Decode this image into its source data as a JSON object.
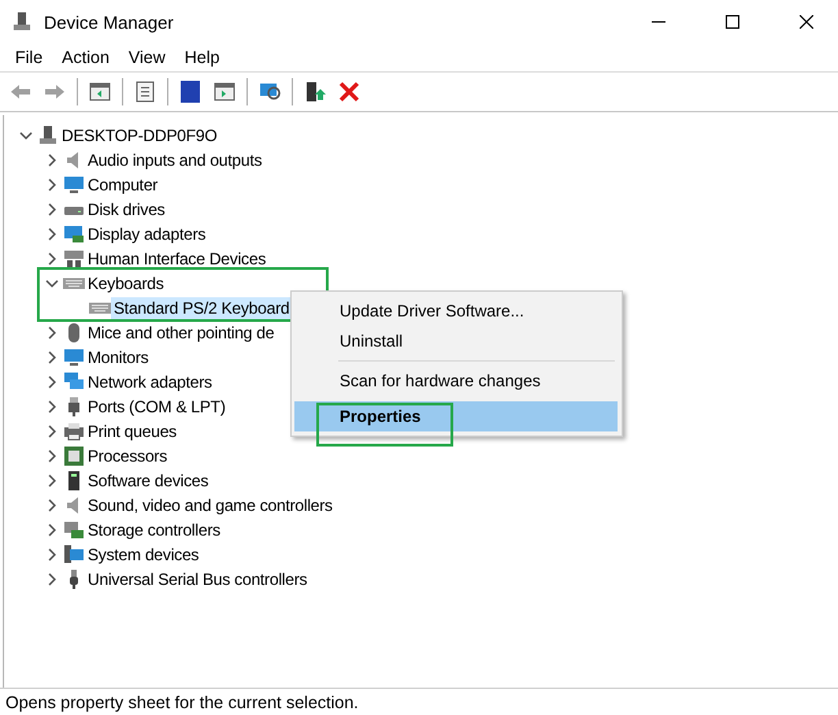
{
  "window": {
    "title": "Device Manager"
  },
  "menu": [
    "File",
    "Action",
    "View",
    "Help"
  ],
  "toolbar": [
    {
      "kind": "back",
      "disabled": true
    },
    {
      "kind": "forward",
      "disabled": true
    },
    {
      "kind": "sep"
    },
    {
      "kind": "tree",
      "disabled": false
    },
    {
      "kind": "sep"
    },
    {
      "kind": "sheet",
      "disabled": false
    },
    {
      "kind": "sep"
    },
    {
      "kind": "help",
      "disabled": false
    },
    {
      "kind": "pane",
      "disabled": false
    },
    {
      "kind": "sep"
    },
    {
      "kind": "scan",
      "disabled": false
    },
    {
      "kind": "sep"
    },
    {
      "kind": "update",
      "disabled": false
    },
    {
      "kind": "remove",
      "disabled": false
    }
  ],
  "tree": {
    "label": "DESKTOP-DDP0F9O",
    "kind": "computer",
    "expanded": true,
    "children": [
      {
        "label": "Audio inputs and outputs",
        "kind": "speaker",
        "expanded": false
      },
      {
        "label": "Computer",
        "kind": "monitor",
        "expanded": false
      },
      {
        "label": "Disk drives",
        "kind": "disk",
        "expanded": false
      },
      {
        "label": "Display adapters",
        "kind": "display",
        "expanded": false
      },
      {
        "label": "Human Interface Devices",
        "kind": "hid",
        "expanded": false
      },
      {
        "label": "Keyboards",
        "kind": "keyboard",
        "expanded": true,
        "annotated": true,
        "children": [
          {
            "label": "Standard PS/2 Keyboard",
            "kind": "keyboard",
            "selected": true
          }
        ]
      },
      {
        "label": "Mice and other pointing de",
        "kind": "mouse",
        "expanded": false
      },
      {
        "label": "Monitors",
        "kind": "monitor",
        "expanded": false
      },
      {
        "label": "Network adapters",
        "kind": "network",
        "expanded": false
      },
      {
        "label": "Ports (COM & LPT)",
        "kind": "port",
        "expanded": false
      },
      {
        "label": "Print queues",
        "kind": "printer",
        "expanded": false
      },
      {
        "label": "Processors",
        "kind": "chip",
        "expanded": false
      },
      {
        "label": "Software devices",
        "kind": "tower",
        "expanded": false
      },
      {
        "label": "Sound, video and game controllers",
        "kind": "speaker",
        "expanded": false
      },
      {
        "label": "Storage controllers",
        "kind": "storage",
        "expanded": false
      },
      {
        "label": "System devices",
        "kind": "system",
        "expanded": false
      },
      {
        "label": "Universal Serial Bus controllers",
        "kind": "usb",
        "expanded": false
      }
    ]
  },
  "context_menu": [
    [
      {
        "label": "Update Driver Software...",
        "selected": false,
        "default": false,
        "annotated": false
      },
      {
        "label": "Uninstall",
        "selected": false,
        "default": false,
        "annotated": false
      }
    ],
    [
      {
        "label": "Scan for hardware changes",
        "selected": false,
        "default": false,
        "annotated": false
      }
    ],
    [
      {
        "label": "Properties",
        "selected": true,
        "default": true,
        "annotated": true
      }
    ]
  ],
  "status_bar": "Opens property sheet for the current selection."
}
